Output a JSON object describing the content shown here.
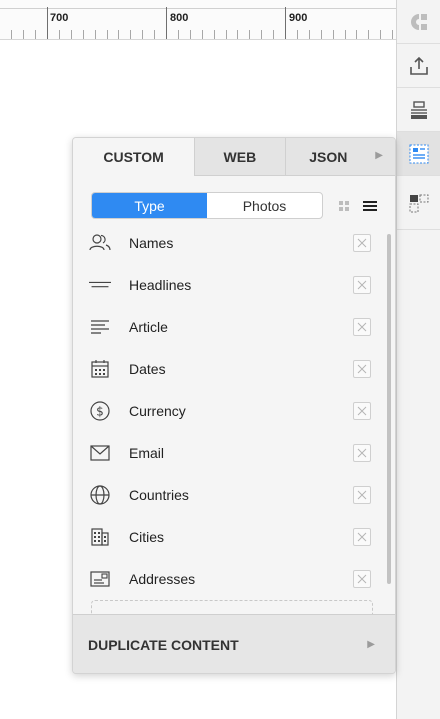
{
  "ruler": {
    "labels": [
      "700",
      "800",
      "900"
    ]
  },
  "toolbar": {
    "items": [
      {
        "name": "plugin-logo-icon"
      },
      {
        "name": "export-icon"
      },
      {
        "name": "print-icon"
      },
      {
        "name": "content-panel-icon"
      },
      {
        "name": "layout-icon"
      }
    ],
    "accent_color": "#2f8af2"
  },
  "panel": {
    "tabs": [
      {
        "label": "CUSTOM",
        "active": true
      },
      {
        "label": "WEB",
        "active": false
      },
      {
        "label": "JSON",
        "active": false
      }
    ],
    "segment": {
      "items": [
        {
          "label": "Type",
          "active": true
        },
        {
          "label": "Photos",
          "active": false
        }
      ]
    },
    "list": [
      {
        "label": "Names",
        "icon": "people-icon"
      },
      {
        "label": "Headlines",
        "icon": "headline-icon"
      },
      {
        "label": "Article",
        "icon": "article-icon"
      },
      {
        "label": "Dates",
        "icon": "calendar-icon"
      },
      {
        "label": "Currency",
        "icon": "dollar-icon"
      },
      {
        "label": "Email",
        "icon": "envelope-icon"
      },
      {
        "label": "Countries",
        "icon": "globe-icon"
      },
      {
        "label": "Cities",
        "icon": "building-icon"
      },
      {
        "label": "Addresses",
        "icon": "address-card-icon"
      }
    ],
    "duplicate_label": "DUPLICATE CONTENT"
  }
}
